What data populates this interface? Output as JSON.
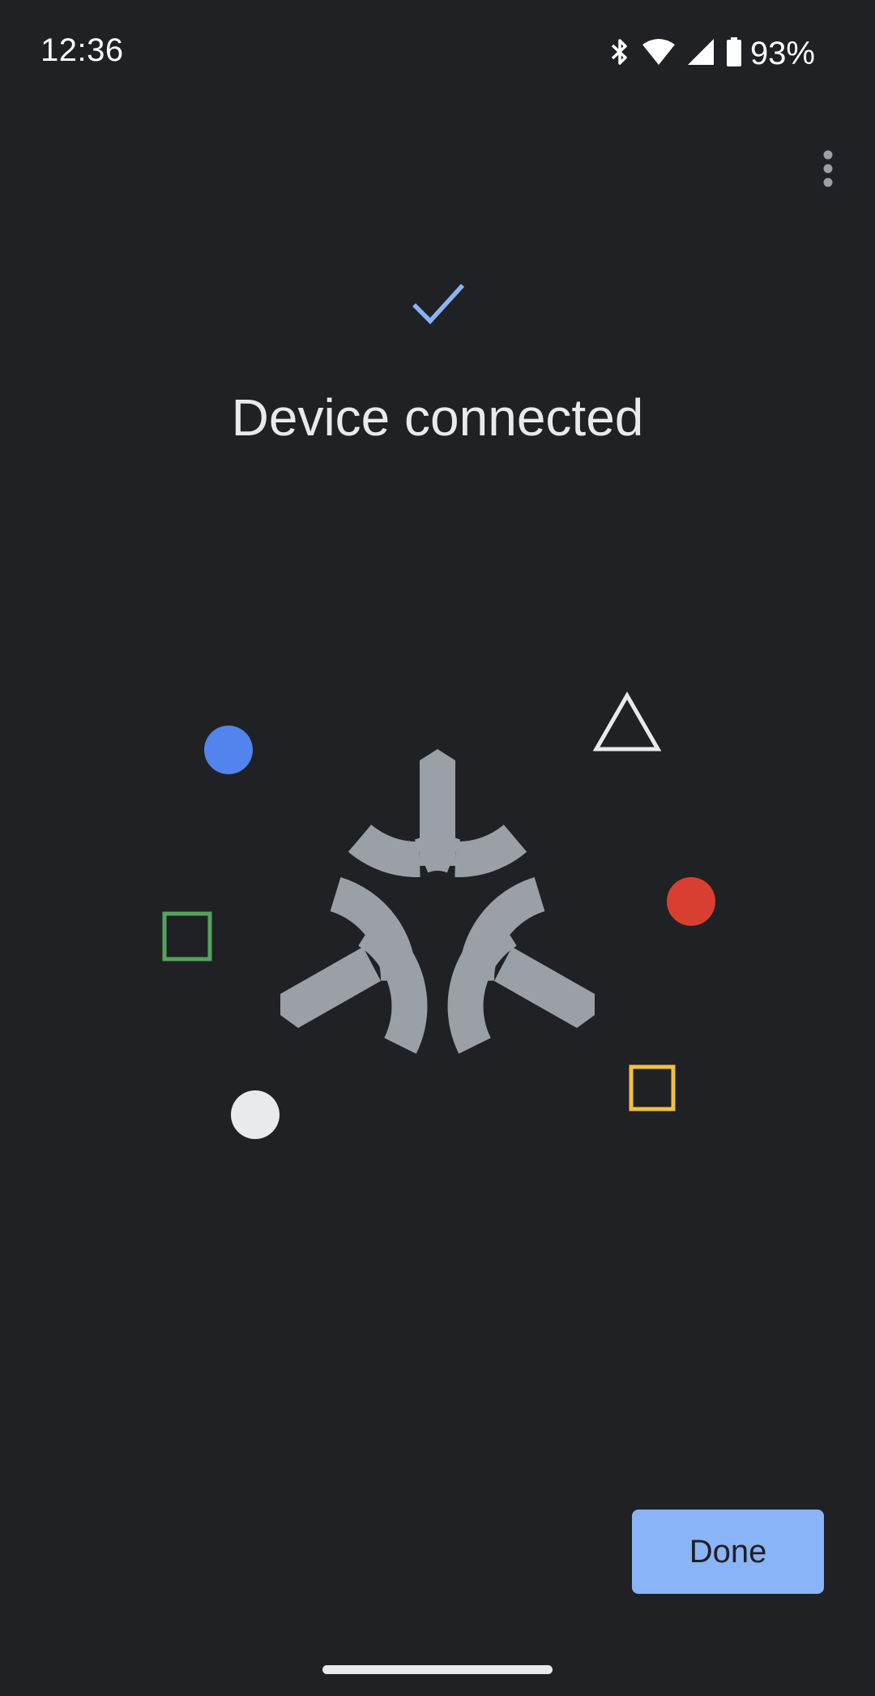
{
  "status_bar": {
    "time": "12:36",
    "battery_percent": "93%",
    "icons": [
      "bluetooth-icon",
      "wifi-icon",
      "cell-signal-icon",
      "battery-icon"
    ]
  },
  "header": {
    "icon": "checkmark-icon",
    "title": "Device connected"
  },
  "illustration": {
    "logo": "matter-logo",
    "logo_color": "#9aa0a6",
    "shapes": [
      {
        "name": "blue-dot",
        "color": "#5383ec"
      },
      {
        "name": "white-triangle-outline",
        "color": "#e8eaed"
      },
      {
        "name": "red-dot",
        "color": "#d93f30"
      },
      {
        "name": "green-square-outline",
        "color": "#55a35c"
      },
      {
        "name": "yellow-square-outline",
        "color": "#f0c142"
      },
      {
        "name": "white-dot",
        "color": "#e8eaed"
      }
    ]
  },
  "actions": {
    "done_label": "Done"
  },
  "colors": {
    "background": "#202124",
    "accent": "#8ab4f8"
  }
}
